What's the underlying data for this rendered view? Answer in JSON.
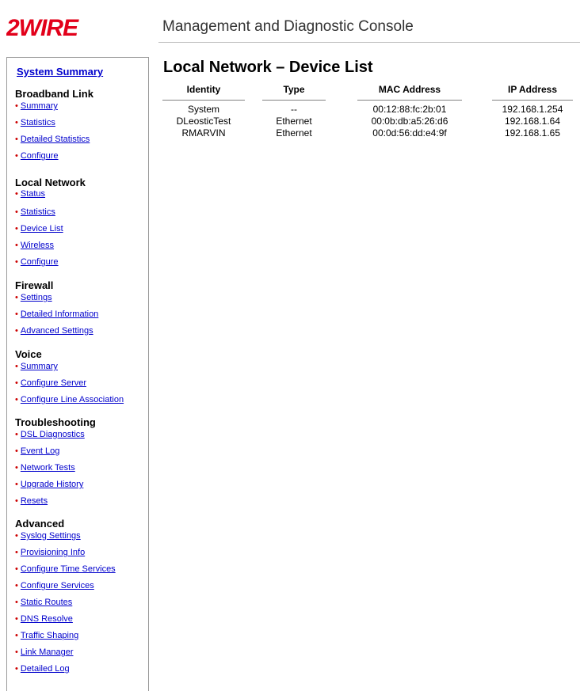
{
  "header": {
    "logo_text": "2WIRE",
    "console_title": "Management and Diagnostic Console"
  },
  "colors": {
    "brand_red": "#e2001a",
    "link_blue": "#0000cc",
    "bullet_red": "#cc0000"
  },
  "sidebar": {
    "system_summary": "System Summary",
    "sections": [
      {
        "title": "Broadband Link",
        "items": [
          "Summary",
          "Statistics",
          "Detailed Statistics",
          "Configure"
        ]
      },
      {
        "title": "Local Network",
        "items": [
          "Status",
          "Statistics",
          "Device List",
          "Wireless",
          "Configure"
        ]
      },
      {
        "title": "Firewall",
        "items": [
          "Settings",
          "Detailed Information",
          "Advanced Settings"
        ]
      },
      {
        "title": "Voice",
        "items": [
          "Summary",
          "Configure Server",
          "Configure Line Association"
        ]
      },
      {
        "title": "Troubleshooting",
        "items": [
          "DSL Diagnostics",
          "Event Log",
          "Network Tests",
          "Upgrade History",
          "Resets"
        ]
      },
      {
        "title": "Advanced",
        "items": [
          "Syslog Settings",
          "Provisioning Info",
          "Configure Time Services",
          "Configure Services",
          "Static Routes",
          "DNS Resolve",
          "Traffic Shaping",
          "Link Manager",
          "Detailed Log"
        ]
      }
    ]
  },
  "main": {
    "title": "Local Network – Device List",
    "columns": [
      "Identity",
      "Type",
      "MAC Address",
      "IP Address"
    ],
    "rows": [
      [
        "System",
        "--",
        "00:12:88:fc:2b:01",
        "192.168.1.254"
      ],
      [
        "DLeosticTest",
        "Ethernet",
        "00:0b:db:a5:26:d6",
        "192.168.1.64"
      ],
      [
        "RMARVIN",
        "Ethernet",
        "00:0d:56:dd:e4:9f",
        "192.168.1.65"
      ]
    ]
  }
}
